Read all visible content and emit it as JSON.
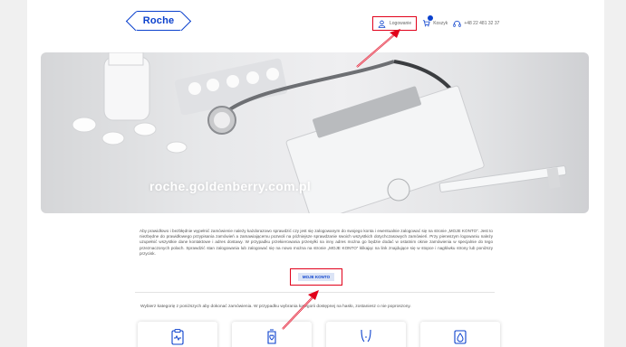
{
  "header": {
    "logo_text": "Roche",
    "login_label": "Logowanie",
    "cart_label": "Koszyk",
    "phone": "+48 22 481 32 37"
  },
  "hero": {
    "watermark": "roche.goldenberry.com.pl"
  },
  "intro": {
    "text": "Aby prawidłowo i bezbłędnie wypełnić zamówienie należy każdorazowo sprawdzić czy jest się zalogowanym do swojego konta i ewentualnie zalogować się na stronie „MOJE KONTO”. Jest to niezbędne do prawidłowego przypisania zamówień a zamawiającemu pozwoli na późniejsze sprawdzanie swoich wszystkich dotychczasowych zamówień. Przy pierwszym logowaniu należy uzupełnić wszystkie dane kontaktowe i adres dostawy. W przypadku przekierowania przesyłki na inny adres można go będzie dodać w ostatnim oknie zamówienia w specjalnie do tego przeznaczonych polach. Sprawdzić stan zalogowania lub zalogować się na nowo można na stronie „MOJE KONTO” klikając na link znajdujące się w stopce i nagłówku strony lub poniższy przycisk."
  },
  "moje_konto_button": "MOJE KONTO",
  "categories": {
    "text": "Wybierz kategorię z poniższych aby dokonać zamówienia. W przypadku wybrania kategorii dostępnej na hasło, zostaniesz o nie poproszony.",
    "cards": [
      {
        "icon": "clipboard-chart-icon"
      },
      {
        "icon": "device-heart-icon"
      },
      {
        "icon": "body-icon"
      },
      {
        "icon": "drop-icon"
      }
    ]
  },
  "colors": {
    "accent": "#0b41cd",
    "highlight": "#e1001a"
  }
}
